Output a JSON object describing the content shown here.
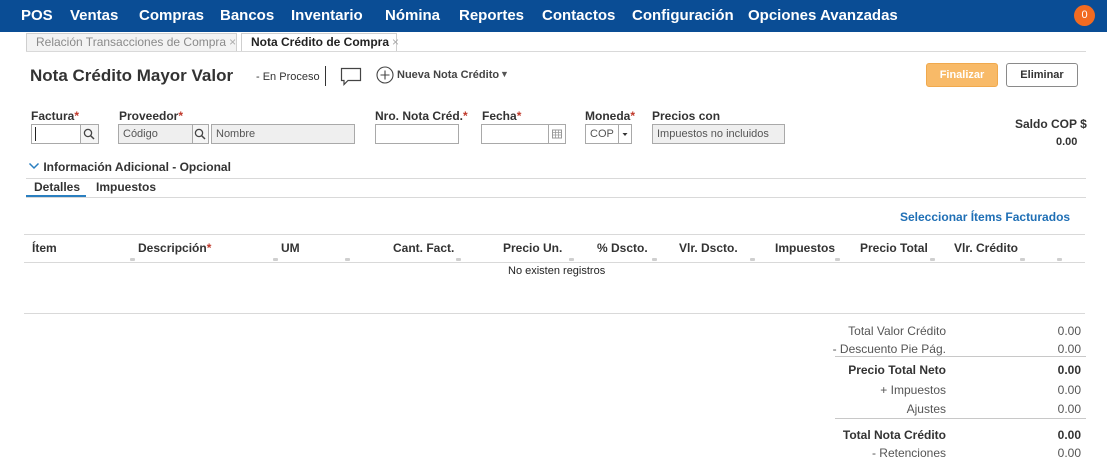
{
  "nav": {
    "items": [
      "POS",
      "Ventas",
      "Compras",
      "Bancos",
      "Inventario",
      "Nómina",
      "Reportes",
      "Contactos",
      "Configuración",
      "Opciones Avanzadas"
    ],
    "notification_count": "0",
    "bar_color": "#0a4d95"
  },
  "tabs": {
    "inactive_label": "Relación Transacciones de Compra",
    "active_label": "Nota Crédito de Compra",
    "close_glyph": "×"
  },
  "header": {
    "title": "Nota Crédito Mayor Valor",
    "status": "- En Proceso",
    "new_note_label": "Nueva Nota Crédito",
    "finalize_label": "Finalizar",
    "delete_label": "Eliminar",
    "finalize_color": "#f8ba68"
  },
  "form": {
    "factura_label": "Factura",
    "proveedor_label": "Proveedor",
    "codigo_placeholder": "Código",
    "nombre_placeholder": "Nombre",
    "nro_label": "Nro. Nota Créd.",
    "fecha_label": "Fecha",
    "moneda_label": "Moneda",
    "moneda_value": "COP",
    "precios_label": "Precios con",
    "precios_value": "Impuestos no incluidos",
    "saldo_label": "Saldo COP $",
    "saldo_value": "0.00",
    "required_mark": "*"
  },
  "info": {
    "label": "Información Adicional - Opcional"
  },
  "subtabs": {
    "detalles": "Detalles",
    "impuestos": "Impuestos"
  },
  "actions": {
    "select_items": "Seleccionar Ítems Facturados"
  },
  "table": {
    "columns": [
      "Ítem",
      "Descripción",
      "UM",
      "Cant. Fact.",
      "Precio Un.",
      "% Dscto.",
      "Vlr. Dscto.",
      "Impuestos",
      "Precio Total",
      "Vlr. Crédito"
    ],
    "empty_message": "No existen registros"
  },
  "totals": [
    {
      "label": "Total Valor Crédito",
      "value": "0.00"
    },
    {
      "label": "- Descuento Pie Pág.",
      "value": "0.00"
    },
    {
      "label": "Precio Total Neto",
      "value": "0.00"
    },
    {
      "label": "+ Impuestos",
      "value": "0.00"
    },
    {
      "label": "Ajustes",
      "value": "0.00"
    },
    {
      "label": "Total Nota Crédito",
      "value": "0.00"
    },
    {
      "label": "- Retenciones",
      "value": "0.00"
    }
  ]
}
